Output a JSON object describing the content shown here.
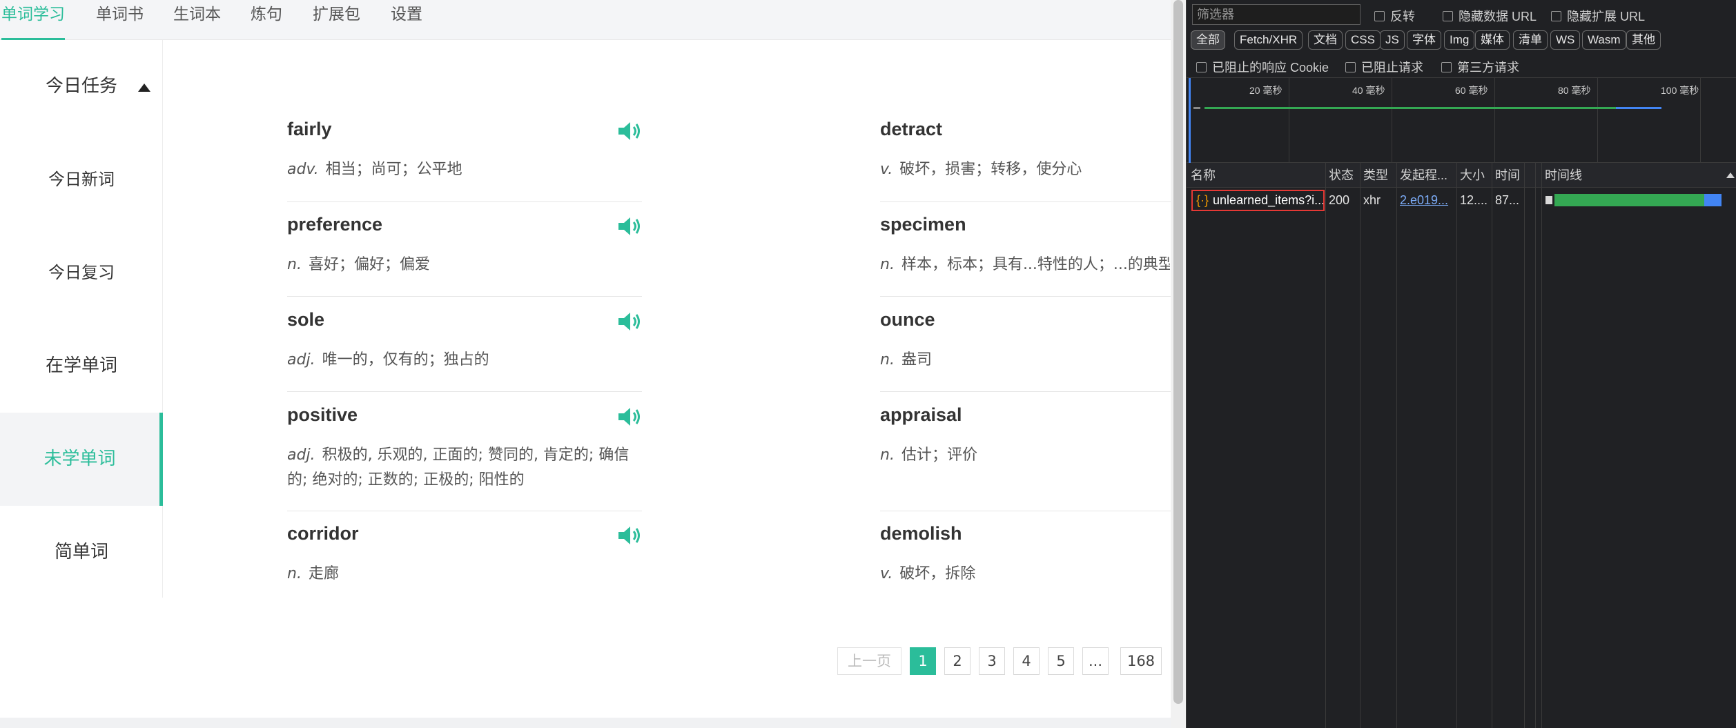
{
  "topnav": {
    "tabs": [
      {
        "label": "单词学习",
        "active": true
      },
      {
        "label": "单词书"
      },
      {
        "label": "生词本"
      },
      {
        "label": "炼句"
      },
      {
        "label": "扩展包"
      },
      {
        "label": "设置"
      }
    ]
  },
  "sidebar": {
    "items": [
      {
        "label": "今日任务"
      },
      {
        "label": "今日新词"
      },
      {
        "label": "今日复习"
      },
      {
        "label": "在学单词"
      },
      {
        "label": "未学单词",
        "active": true
      },
      {
        "label": "简单词"
      }
    ]
  },
  "words": {
    "left": [
      {
        "word": "fairly",
        "pos": "adv.",
        "meaning": "相当；尚可；公平地"
      },
      {
        "word": "preference",
        "pos": "n.",
        "meaning": "喜好；偏好；偏爱"
      },
      {
        "word": "sole",
        "pos": "adj.",
        "meaning": "唯一的，仅有的；独占的"
      },
      {
        "word": "positive",
        "pos": "adj.",
        "meaning": "积极的, 乐观的, 正面的; 赞同的, 肯定的; 确信的; 绝对的; 正数的; 正极的; 阳性的"
      },
      {
        "word": "corridor",
        "pos": "n.",
        "meaning": "走廊"
      }
    ],
    "right": [
      {
        "word": "detract",
        "pos": "v.",
        "meaning": "破坏，损害；转移，使分心"
      },
      {
        "word": "specimen",
        "pos": "n.",
        "meaning": "样本，标本；具有...特性的人；...的典型"
      },
      {
        "word": "ounce",
        "pos": "n.",
        "meaning": "盎司"
      },
      {
        "word": "appraisal",
        "pos": "n.",
        "meaning": "估计；评价"
      },
      {
        "word": "demolish",
        "pos": "v.",
        "meaning": "破坏，拆除"
      }
    ]
  },
  "pagination": {
    "prev": "上一页",
    "pages": [
      "1",
      "2",
      "3",
      "4",
      "5",
      "...",
      "168"
    ],
    "current": "1"
  },
  "devtools": {
    "filter_placeholder": "筛选器",
    "checkboxes_row1": [
      "反转",
      "隐藏数据 URL",
      "隐藏扩展 URL"
    ],
    "type_filters": [
      "全部",
      "Fetch/XHR",
      "文档",
      "CSS",
      "JS",
      "字体",
      "Img",
      "媒体",
      "清单",
      "WS",
      "Wasm",
      "其他"
    ],
    "checkboxes_row2": [
      "已阻止的响应 Cookie",
      "已阻止请求",
      "第三方请求"
    ],
    "timeline_labels": [
      "20 毫秒",
      "40 毫秒",
      "60 毫秒",
      "80 毫秒",
      "100 毫秒"
    ],
    "columns": [
      "名称",
      "状态",
      "类型",
      "发起程...",
      "大小",
      "时间",
      "",
      "时间线"
    ],
    "request": {
      "name": "unlearned_items?i...",
      "status": "200",
      "type": "xhr",
      "initiator": "2.e019...",
      "size": "12....",
      "time": "87..."
    },
    "colors": {
      "waiting": "#34a853",
      "download": "#4285f4",
      "highlight": "#e53935"
    }
  }
}
